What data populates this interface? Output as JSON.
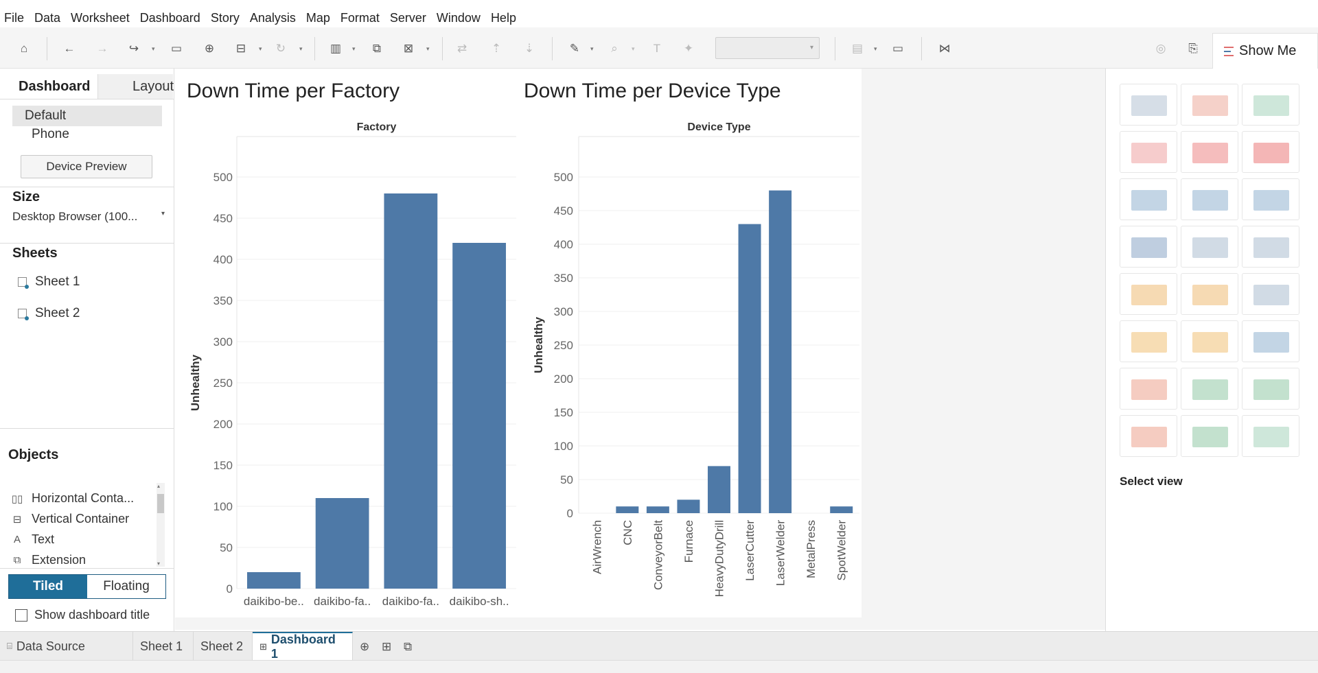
{
  "menu": [
    "File",
    "Data",
    "Worksheet",
    "Dashboard",
    "Story",
    "Analysis",
    "Map",
    "Format",
    "Server",
    "Window",
    "Help"
  ],
  "toolbar": {
    "show_me_label": "Show Me"
  },
  "left_panel": {
    "tabs": {
      "dashboard": "Dashboard",
      "layout": "Layout"
    },
    "device_options": {
      "default": "Default",
      "phone": "Phone"
    },
    "device_preview": "Device Preview",
    "size_heading": "Size",
    "size_value": "Desktop Browser (100...",
    "sheets_heading": "Sheets",
    "sheets": [
      "Sheet 1",
      "Sheet 2"
    ],
    "objects_heading": "Objects",
    "objects": [
      "Horizontal Conta...",
      "Vertical Container",
      "Text",
      "Extension"
    ],
    "tiled_label": "Tiled",
    "floating_label": "Floating",
    "show_title_label": "Show dashboard title"
  },
  "chart_data": [
    {
      "type": "bar",
      "title": "Down Time per Factory",
      "column_header": "Factory",
      "ylabel": "Unhealthy",
      "categories": [
        "daikibo-be..",
        "daikibo-fa..",
        "daikibo-fa..",
        "daikibo-sh.."
      ],
      "values": [
        20,
        110,
        480,
        420
      ],
      "ylim": [
        0,
        500
      ],
      "yticks": [
        0,
        50,
        100,
        150,
        200,
        250,
        300,
        350,
        400,
        450,
        500
      ],
      "color": "#4e79a7"
    },
    {
      "type": "bar",
      "title": "Down Time per Device Type",
      "column_header": "Device Type",
      "ylabel": "Unhealthy",
      "categories": [
        "AirWrench",
        "CNC",
        "ConveyorBelt",
        "Furnace",
        "HeavyDutyDrill",
        "LaserCutter",
        "LaserWelder",
        "MetalPress",
        "SpotWelder"
      ],
      "values": [
        0,
        10,
        10,
        20,
        70,
        430,
        480,
        0,
        10
      ],
      "ylim": [
        0,
        500
      ],
      "yticks": [
        0,
        50,
        100,
        150,
        200,
        250,
        300,
        350,
        400,
        450,
        500
      ],
      "color": "#4e79a7"
    }
  ],
  "show_me": {
    "footer": "Select view"
  },
  "bottom_tabs": {
    "data_source": "Data Source",
    "sheet1": "Sheet 1",
    "sheet2": "Sheet 2",
    "dashboard1": "Dashboard 1"
  }
}
